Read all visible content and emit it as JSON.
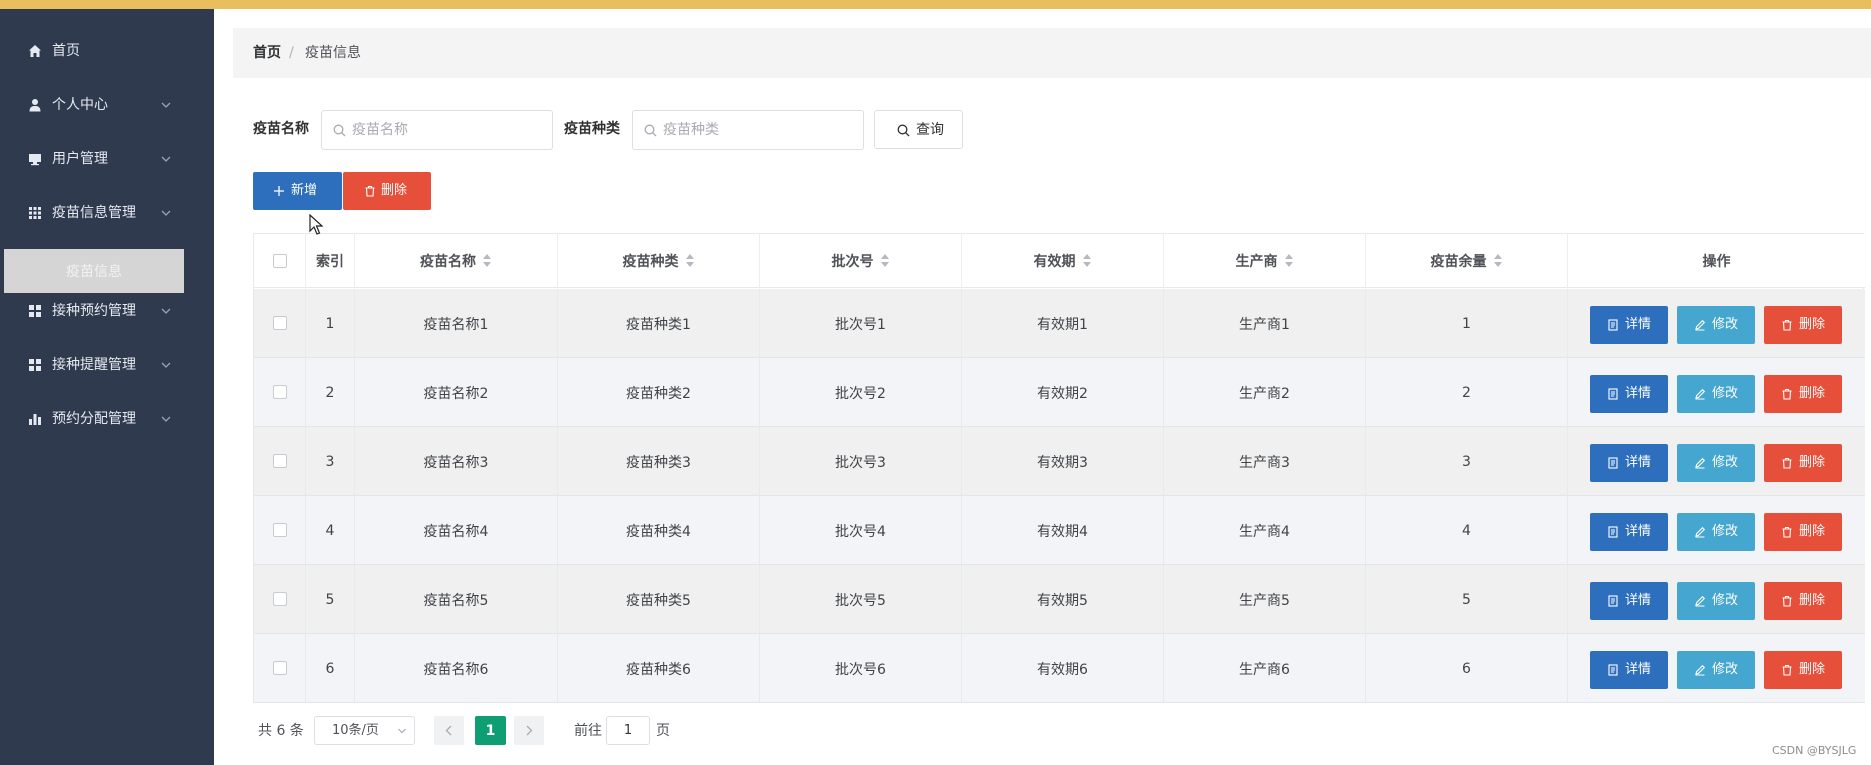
{
  "colors": {
    "top_bar": "#e8bf5c",
    "sidebar_bg": "#2f3a4f",
    "primary_blue": "#2e6fbd",
    "danger_red": "#e6503b",
    "info_cyan": "#45a6d0",
    "pager_active": "#0f9d74"
  },
  "sidebar": {
    "items": [
      {
        "label": "首页",
        "icon": "home-icon"
      },
      {
        "label": "个人中心",
        "icon": "user-icon"
      },
      {
        "label": "用户管理",
        "icon": "monitor-icon"
      },
      {
        "label": "疫苗信息管理",
        "icon": "grid-icon"
      },
      {
        "label": "接种预约管理",
        "icon": "apps-icon"
      },
      {
        "label": "接种提醒管理",
        "icon": "apps-icon"
      },
      {
        "label": "预约分配管理",
        "icon": "bar-chart-icon"
      }
    ],
    "active_sub": "疫苗信息"
  },
  "breadcrumb": {
    "home": "首页",
    "separator": "/",
    "current": "疫苗信息"
  },
  "search": {
    "name_label": "疫苗名称",
    "name_placeholder": "疫苗名称",
    "type_label": "疫苗种类",
    "type_placeholder": "疫苗种类",
    "query_button": "查询"
  },
  "toolbar": {
    "add_label": "新增",
    "delete_label": "删除"
  },
  "table": {
    "columns": [
      "索引",
      "疫苗名称",
      "疫苗种类",
      "批次号",
      "有效期",
      "生产商",
      "疫苗余量",
      "操作"
    ],
    "rows": [
      [
        "1",
        "疫苗名称1",
        "疫苗种类1",
        "批次号1",
        "有效期1",
        "生产商1",
        "1"
      ],
      [
        "2",
        "疫苗名称2",
        "疫苗种类2",
        "批次号2",
        "有效期2",
        "生产商2",
        "2"
      ],
      [
        "3",
        "疫苗名称3",
        "疫苗种类3",
        "批次号3",
        "有效期3",
        "生产商3",
        "3"
      ],
      [
        "4",
        "疫苗名称4",
        "疫苗种类4",
        "批次号4",
        "有效期4",
        "生产商4",
        "4"
      ],
      [
        "5",
        "疫苗名称5",
        "疫苗种类5",
        "批次号5",
        "有效期5",
        "生产商5",
        "5"
      ],
      [
        "6",
        "疫苗名称6",
        "疫苗种类6",
        "批次号6",
        "有效期6",
        "生产商6",
        "6"
      ]
    ],
    "actions": {
      "detail": "详情",
      "edit": "修改",
      "delete": "删除"
    }
  },
  "pager": {
    "total": "共 6 条",
    "page_size": "10条/页",
    "current_page": "1",
    "goto_label": "前往",
    "goto_value": "1",
    "page_suffix": "页"
  },
  "watermark": "CSDN @BYSJLG"
}
